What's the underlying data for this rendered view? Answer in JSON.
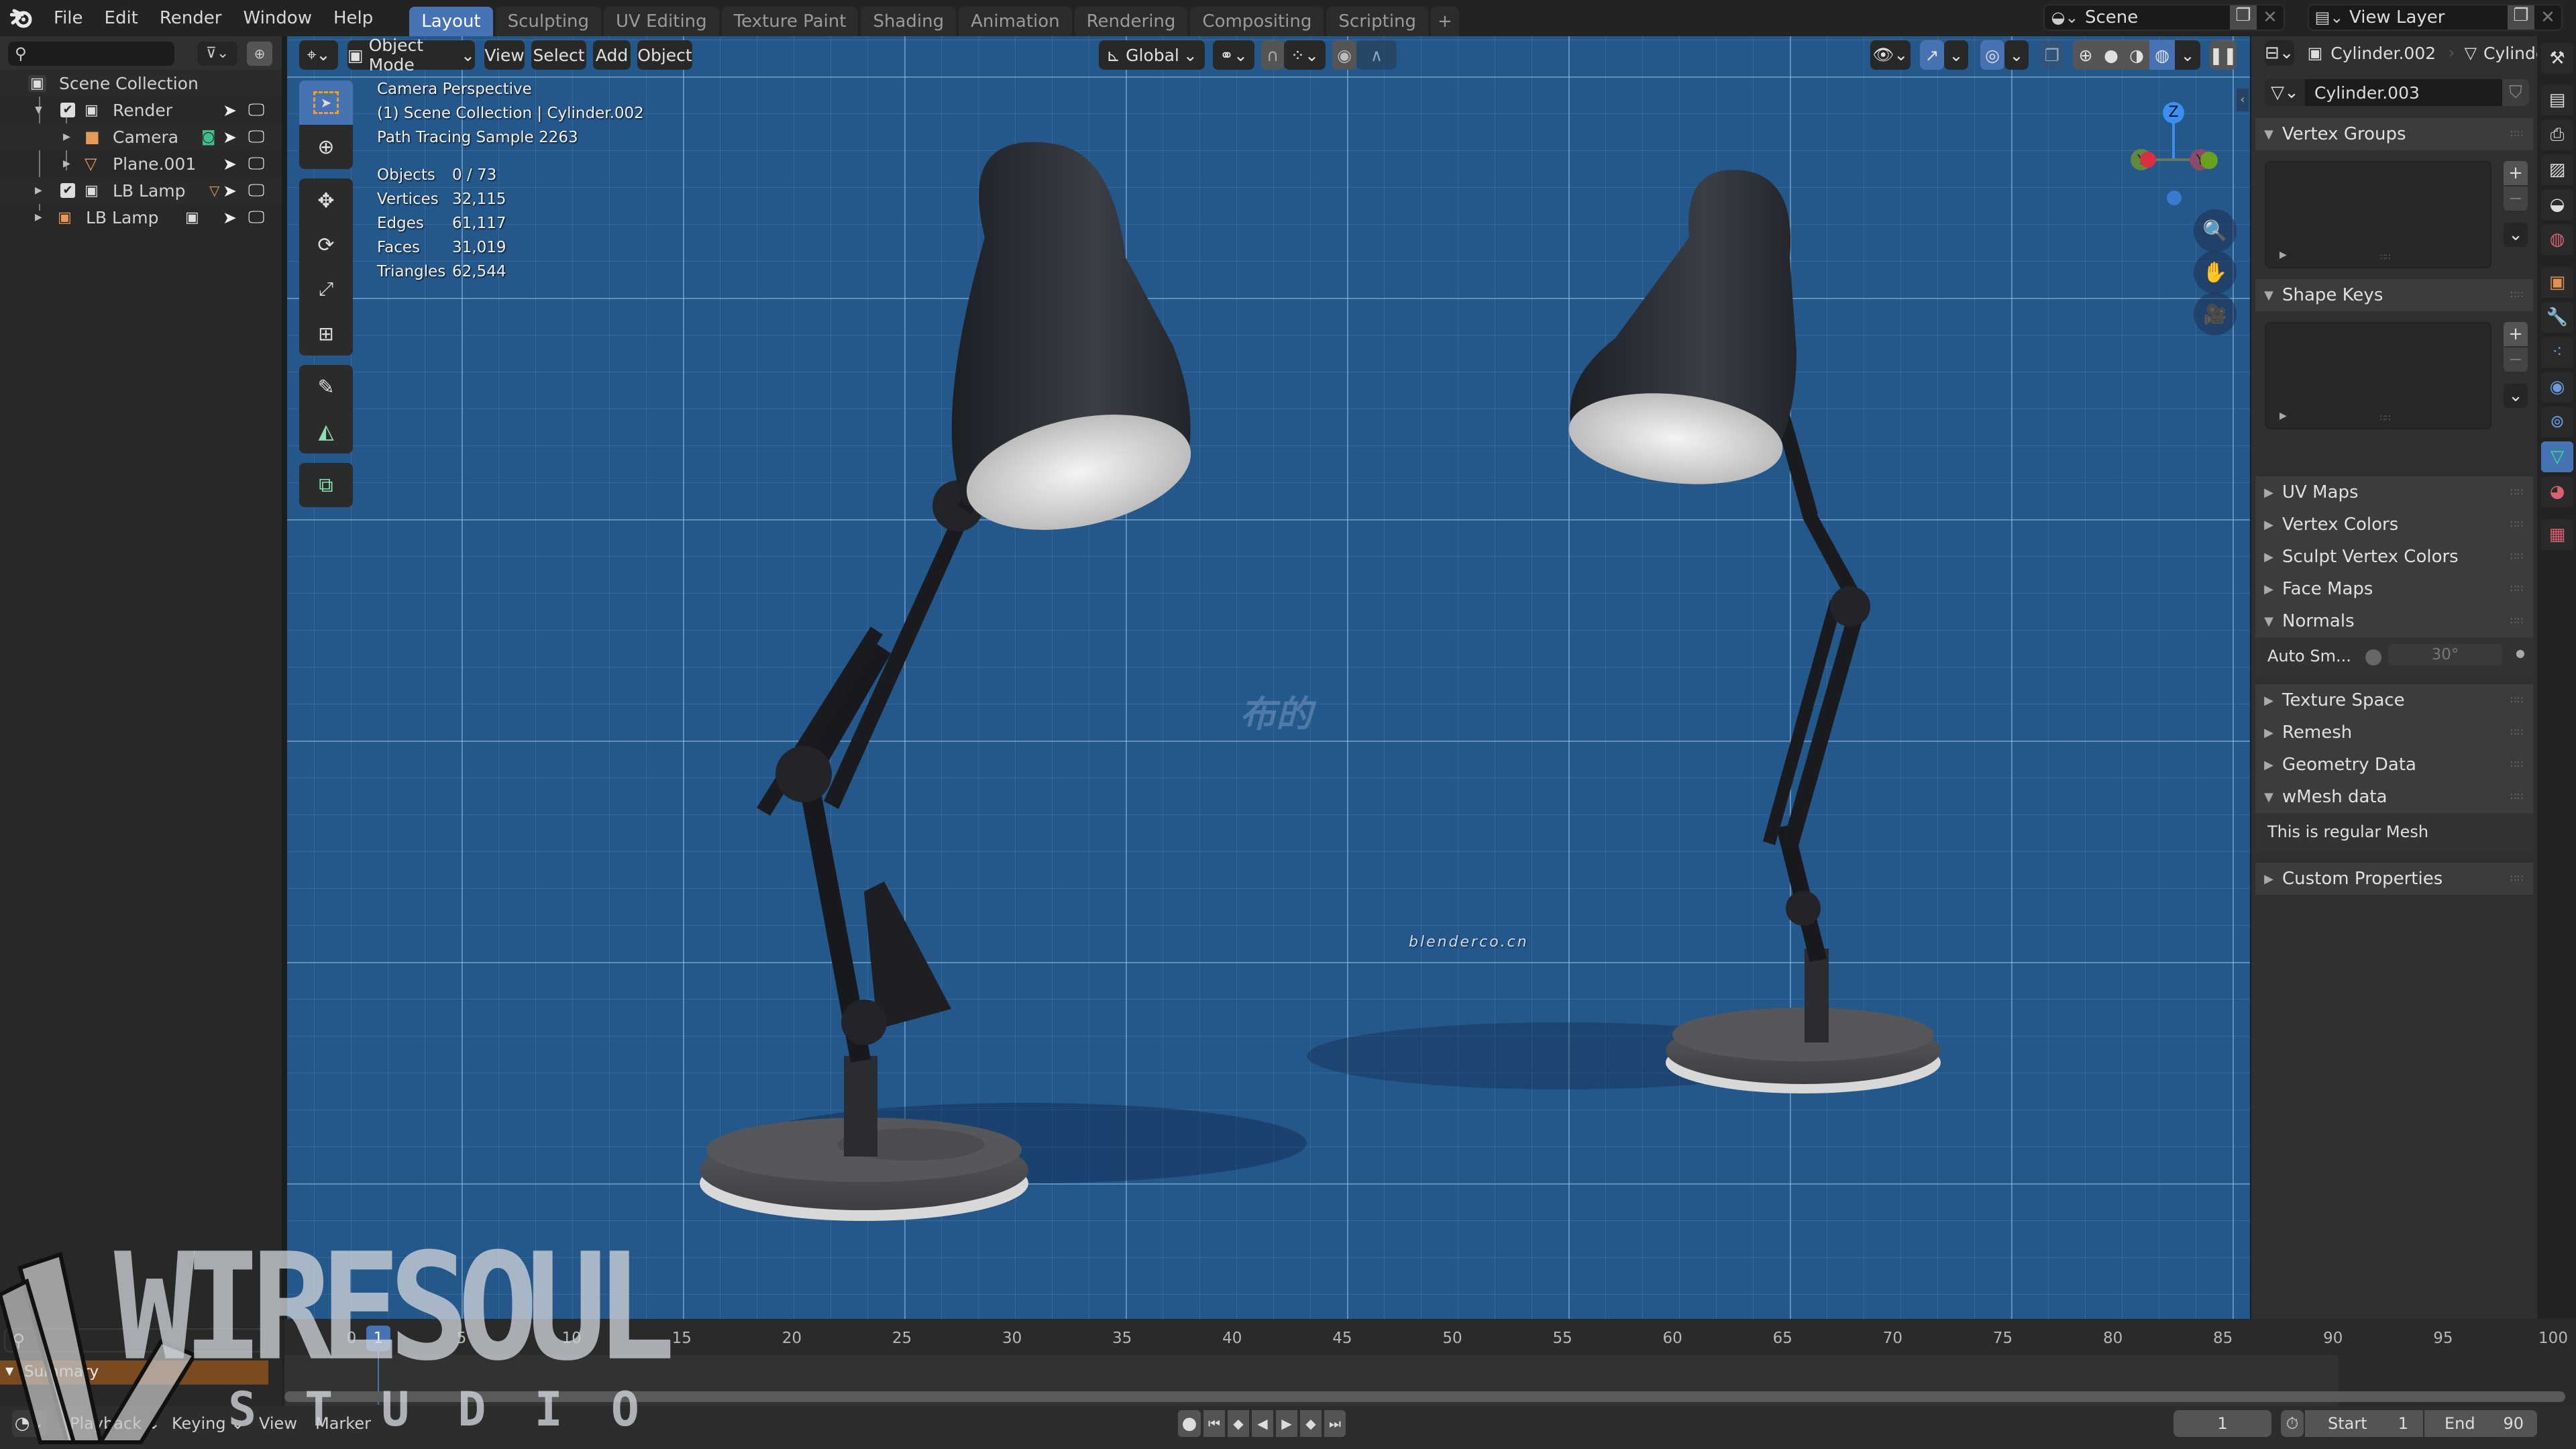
{
  "topbar": {
    "menus": [
      "File",
      "Edit",
      "Render",
      "Window",
      "Help"
    ],
    "workspaces": [
      "Layout",
      "Sculpting",
      "UV Editing",
      "Texture Paint",
      "Shading",
      "Animation",
      "Rendering",
      "Compositing",
      "Scripting"
    ],
    "active_workspace": "Layout",
    "add_workspace": "+",
    "scene": "Scene",
    "view_layer": "View Layer"
  },
  "outliner": {
    "search_placeholder": "",
    "items": [
      {
        "label": "Scene Collection",
        "type": "collection"
      },
      {
        "label": "Render",
        "type": "collection",
        "checked": true
      },
      {
        "label": "Camera",
        "type": "camera"
      },
      {
        "label": "Plane.001",
        "type": "mesh"
      },
      {
        "label": "LB Lamp",
        "type": "collection",
        "checked": true
      },
      {
        "label": "LB Lamp",
        "type": "collection-instance"
      }
    ]
  },
  "viewport": {
    "header": {
      "mode": "Object Mode",
      "menus": [
        "View",
        "Select",
        "Add",
        "Object"
      ],
      "orientation": "Global"
    },
    "overlay": {
      "view_name": "Camera Perspective",
      "context": "(1) Scene Collection | Cylinder.002",
      "render_status": "Path Tracing Sample 2263",
      "stats": [
        {
          "label": "Objects",
          "value": "0 / 73"
        },
        {
          "label": "Vertices",
          "value": "32,115"
        },
        {
          "label": "Edges",
          "value": "61,117"
        },
        {
          "label": "Faces",
          "value": "31,019"
        },
        {
          "label": "Triangles",
          "value": "62,544"
        }
      ]
    },
    "gizmo": {
      "z": "Z",
      "y": "Y",
      "y_neg": "Y"
    },
    "watermarks": {
      "center_cn": "布的",
      "site": "blenderco.cn",
      "logo_top": "WIRESOUL",
      "logo_bottom": "STUDIO"
    }
  },
  "properties": {
    "breadcrumb": {
      "object": "Cylinder.002",
      "data": "Cylinder"
    },
    "mesh_name": "Cylinder.003",
    "panels": [
      {
        "label": "Vertex Groups",
        "open": true
      },
      {
        "label": "Shape Keys",
        "open": true
      },
      {
        "label": "UV Maps",
        "open": false
      },
      {
        "label": "Vertex Colors",
        "open": false
      },
      {
        "label": "Sculpt Vertex Colors",
        "open": false
      },
      {
        "label": "Face Maps",
        "open": false
      },
      {
        "label": "Normals",
        "open": true
      },
      {
        "label": "Texture Space",
        "open": false
      },
      {
        "label": "Remesh",
        "open": false
      },
      {
        "label": "Geometry Data",
        "open": false
      },
      {
        "label": "wMesh data",
        "open": true
      },
      {
        "label": "Custom Properties",
        "open": false
      }
    ],
    "normals": {
      "auto_smooth_label": "Auto Sm...",
      "angle": "30°"
    },
    "wmesh_text": "This is regular Mesh",
    "tabs": [
      "tool",
      "render",
      "output",
      "view-layer",
      "scene",
      "world",
      "object",
      "modifiers",
      "particles",
      "physics",
      "constraints",
      "data",
      "material",
      "texture"
    ],
    "active_tab": "data"
  },
  "timeline": {
    "summary_label": "Summary",
    "ticks": [
      "0",
      "5",
      "10",
      "15",
      "20",
      "25",
      "30",
      "35",
      "40",
      "45",
      "50",
      "55",
      "60",
      "65",
      "70",
      "75",
      "80",
      "85",
      "90",
      "95",
      "100"
    ],
    "current_frame": "1",
    "menus": [
      "Playback",
      "Keying",
      "View",
      "Marker"
    ],
    "frame_field": "1",
    "start_label": "Start",
    "start": "1",
    "end_label": "End",
    "end": "90"
  }
}
